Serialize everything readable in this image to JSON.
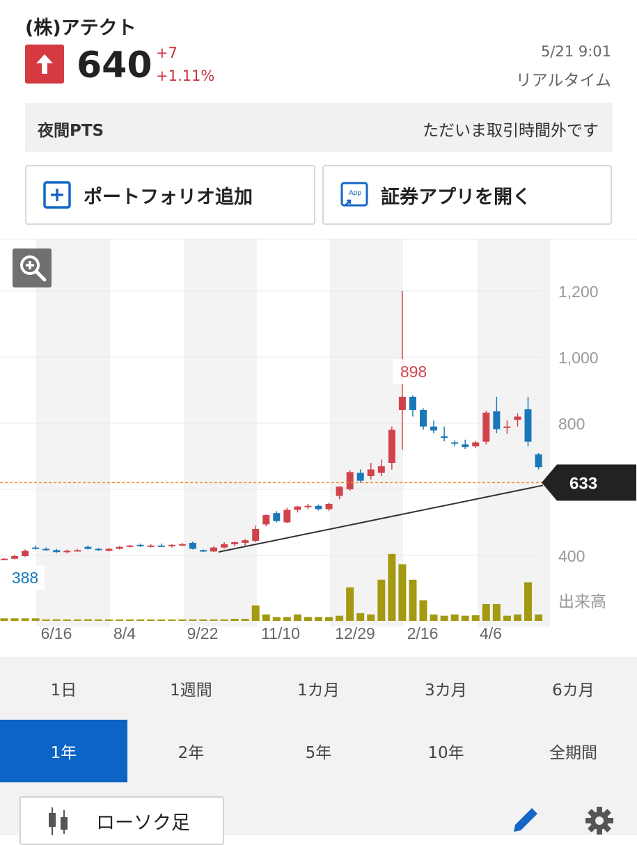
{
  "header": {
    "name": "(株)アテクト",
    "price": "640",
    "change_abs": "+7",
    "change_pct": "+1.11%",
    "timestamp": "5/21 9:01",
    "realtime_label": "リアルタイム",
    "direction": "up",
    "up_color": "#d43a40"
  },
  "pts": {
    "label": "夜間PTS",
    "status": "ただいま取引時間外です"
  },
  "actions": {
    "portfolio_label": "ポートフォリオ追加",
    "app_label": "証券アプリを開く",
    "app_icon_text": "App"
  },
  "chart_data": {
    "type": "candlestick",
    "y_ticks": [
      "1,200",
      "1,000",
      "800",
      "400"
    ],
    "x_ticks": [
      "6/16",
      "8/4",
      "9/22",
      "11/10",
      "12/29",
      "2/16",
      "4/6"
    ],
    "ylim": [
      380,
      1240
    ],
    "current_price_tag": "633",
    "current_price": 633,
    "high_label": "898",
    "low_label": "388",
    "volume_label": "出来高",
    "up_color": "#d0434b",
    "down_color": "#1a78b8",
    "volume_color": "#a49a12",
    "trendline": [
      [
        9.5,
        388
      ],
      [
        42.5,
        633
      ]
    ],
    "ohlc": [
      [
        0,
        388,
        392,
        386,
        390
      ],
      [
        1,
        390,
        402,
        388,
        398
      ],
      [
        2,
        398,
        418,
        396,
        414
      ],
      [
        3,
        424,
        430,
        418,
        420
      ],
      [
        4,
        420,
        424,
        414,
        416
      ],
      [
        5,
        416,
        420,
        408,
        410
      ],
      [
        6,
        410,
        418,
        406,
        414
      ],
      [
        7,
        414,
        420,
        412,
        416
      ],
      [
        8,
        426,
        430,
        418,
        420
      ],
      [
        9,
        420,
        422,
        414,
        416
      ],
      [
        10,
        414,
        422,
        412,
        420
      ],
      [
        11,
        420,
        428,
        418,
        426
      ],
      [
        12,
        426,
        432,
        424,
        430
      ],
      [
        13,
        432,
        436,
        426,
        428
      ],
      [
        14,
        428,
        434,
        424,
        430
      ],
      [
        15,
        430,
        436,
        426,
        428
      ],
      [
        16,
        428,
        434,
        424,
        432
      ],
      [
        17,
        432,
        438,
        428,
        434
      ],
      [
        18,
        438,
        442,
        418,
        420
      ],
      [
        19,
        416,
        418,
        410,
        412
      ],
      [
        20,
        412,
        428,
        410,
        424
      ],
      [
        21,
        424,
        440,
        420,
        434
      ],
      [
        22,
        434,
        442,
        428,
        440
      ],
      [
        23,
        438,
        450,
        430,
        446
      ],
      [
        24,
        444,
        490,
        440,
        480
      ],
      [
        25,
        494,
        524,
        488,
        522
      ],
      [
        26,
        528,
        534,
        500,
        504
      ],
      [
        27,
        500,
        544,
        498,
        538
      ],
      [
        28,
        538,
        550,
        530,
        548
      ],
      [
        29,
        548,
        556,
        540,
        550
      ],
      [
        30,
        550,
        554,
        536,
        540
      ],
      [
        31,
        540,
        560,
        534,
        556
      ],
      [
        32,
        580,
        610,
        570,
        608
      ],
      [
        33,
        600,
        658,
        596,
        652
      ],
      [
        34,
        650,
        660,
        620,
        626
      ],
      [
        35,
        640,
        680,
        630,
        660
      ],
      [
        36,
        650,
        690,
        640,
        670
      ],
      [
        37,
        680,
        790,
        660,
        780
      ],
      [
        38,
        840,
        1200,
        720,
        880
      ],
      [
        39,
        880,
        884,
        820,
        840
      ],
      [
        40,
        840,
        845,
        780,
        790
      ],
      [
        41,
        790,
        808,
        770,
        778
      ],
      [
        42,
        760,
        790,
        745,
        756
      ],
      [
        43,
        742,
        748,
        730,
        738
      ],
      [
        44,
        736,
        750,
        722,
        728
      ],
      [
        45,
        730,
        746,
        724,
        742
      ],
      [
        46,
        744,
        838,
        736,
        832
      ],
      [
        47,
        836,
        880,
        770,
        782
      ],
      [
        48,
        788,
        808,
        768,
        790
      ],
      [
        49,
        810,
        830,
        790,
        820
      ],
      [
        50,
        842,
        880,
        730,
        744
      ],
      [
        51,
        706,
        710,
        660,
        667
      ]
    ],
    "volume": [
      1,
      1,
      1,
      1,
      0.5,
      0.5,
      0.5,
      0.5,
      0.6,
      0.5,
      0.4,
      0.4,
      0.4,
      0.4,
      0.4,
      0.5,
      0.4,
      0.4,
      0.4,
      0.4,
      0.3,
      0.4,
      0.8,
      0.8,
      6,
      2.5,
      1.5,
      1.5,
      2.5,
      1.5,
      1.5,
      1.5,
      2,
      13,
      3,
      2.5,
      16,
      26,
      22,
      16,
      8,
      2.5,
      2,
      2.5,
      2,
      2.2,
      6.5,
      6.5,
      2,
      2.5,
      15,
      2.5
    ]
  },
  "ranges": {
    "row1": [
      "1日",
      "1週間",
      "1カ月",
      "3カ月",
      "6カ月"
    ],
    "row2": [
      "1年",
      "2年",
      "5年",
      "10年",
      "全期間"
    ],
    "active": "1年"
  },
  "bottom": {
    "chart_type_label": "ローソク足"
  },
  "colors": {
    "accent": "#0b64c6",
    "up": "#d43a40",
    "tag_bg": "#222222"
  }
}
